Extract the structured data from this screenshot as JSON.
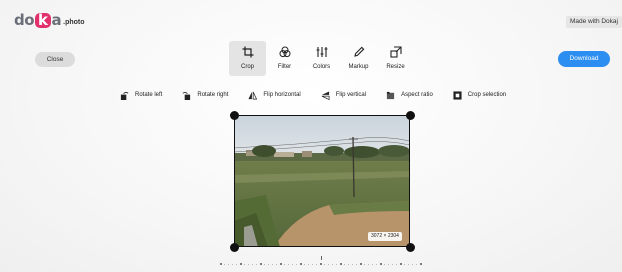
{
  "app": {
    "logo_mark": "doka",
    "logo_suffix": ".photo",
    "made_with": "Made with Dokaj"
  },
  "header": {
    "close_label": "Close",
    "download_label": "Download"
  },
  "tabs": [
    {
      "label": "Crop",
      "icon": "crop-icon",
      "active": true
    },
    {
      "label": "Filter",
      "icon": "filter-icon",
      "active": false
    },
    {
      "label": "Colors",
      "icon": "sliders-icon",
      "active": false
    },
    {
      "label": "Markup",
      "icon": "pencil-icon",
      "active": false
    },
    {
      "label": "Resize",
      "icon": "resize-icon",
      "active": false
    }
  ],
  "tools": [
    {
      "label": "Rotate left",
      "icon": "rotate-left-icon"
    },
    {
      "label": "Rotate right",
      "icon": "rotate-right-icon"
    },
    {
      "label": "Flip horizontal",
      "icon": "flip-horizontal-icon"
    },
    {
      "label": "Flip vertical",
      "icon": "flip-vertical-icon"
    },
    {
      "label": "Aspect ratio",
      "icon": "aspect-ratio-icon"
    },
    {
      "label": "Crop selection",
      "icon": "crop-selection-icon"
    }
  ],
  "image": {
    "size_label": "3072 × 2304"
  },
  "colors": {
    "accent": "#2b8ef0",
    "logo_highlight": "#e1306c"
  }
}
